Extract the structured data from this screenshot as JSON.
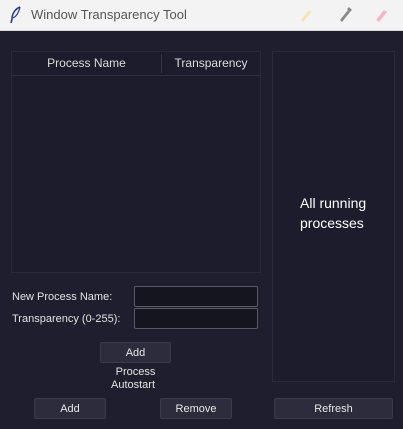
{
  "window": {
    "title": "Window Transparency Tool"
  },
  "table": {
    "columns": [
      "Process Name",
      "Transparency"
    ],
    "rows": []
  },
  "process_list": {
    "label": "All running processes"
  },
  "form": {
    "process_name_label": "New Process Name:",
    "process_name_value": "",
    "transparency_label": "Transparency (0-255):",
    "transparency_value": ""
  },
  "buttons": {
    "add_process": "Add Process",
    "add": "Add",
    "remove": "Remove",
    "refresh": "Refresh"
  },
  "autostart": {
    "label": "Autostart"
  },
  "colors": {
    "background": "#1e1e2e",
    "titlebar": "#f3f3f3",
    "accent_yellow": "#f7e3a8",
    "accent_pink": "#f4b8c4"
  }
}
